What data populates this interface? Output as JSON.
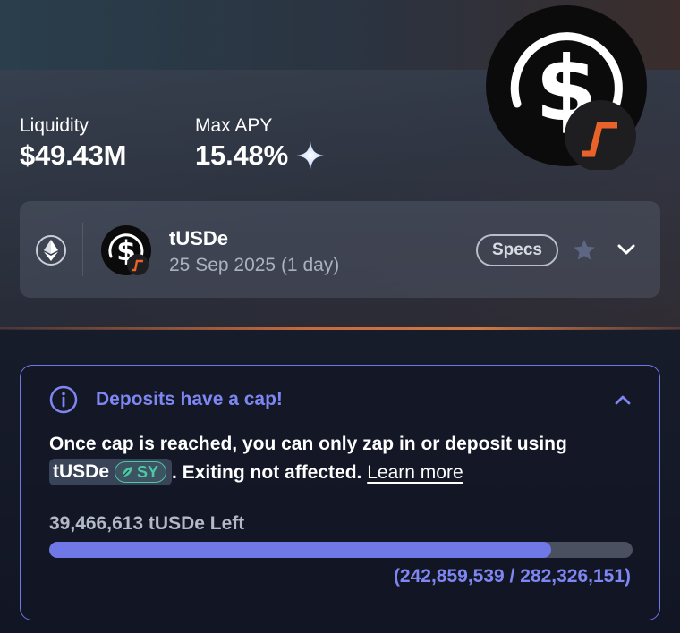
{
  "hero": {
    "logo_icon": "tusde-coin-icon",
    "stats": [
      {
        "label": "Liquidity",
        "value": "$49.43M"
      },
      {
        "label": "Max APY",
        "value": "15.48%",
        "icon": "sparkle-icon"
      }
    ]
  },
  "market": {
    "chain_icon": "ethereum-icon",
    "token_icon": "tusde-coin-icon",
    "name": "tUSDe",
    "maturity": "25 Sep 2025 (1 day)",
    "specs_label": "Specs",
    "favorite_icon": "star-icon",
    "expand_icon": "chevron-down-icon"
  },
  "cap_notice": {
    "icon": "info-icon",
    "title": "Deposits have a cap!",
    "collapse_icon": "chevron-up-icon",
    "text_before": "Once cap is reached, you can only zap in or deposit using",
    "chip_token": "tUSDe",
    "chip_badge": "SY",
    "chip_badge_icon": "leaf-icon",
    "text_after": ". Exiting not affected.",
    "learn_more": "Learn more",
    "remaining": "39,466,613 tUSDe Left",
    "ratio": "(242,859,539 / 282,326,151)",
    "progress_fraction": 0.8602
  },
  "colors": {
    "accent": "#7078e8",
    "sy_green": "#4fc7a4",
    "divider_orange": "#c76a3e",
    "logo_orange": "#e8622a"
  }
}
